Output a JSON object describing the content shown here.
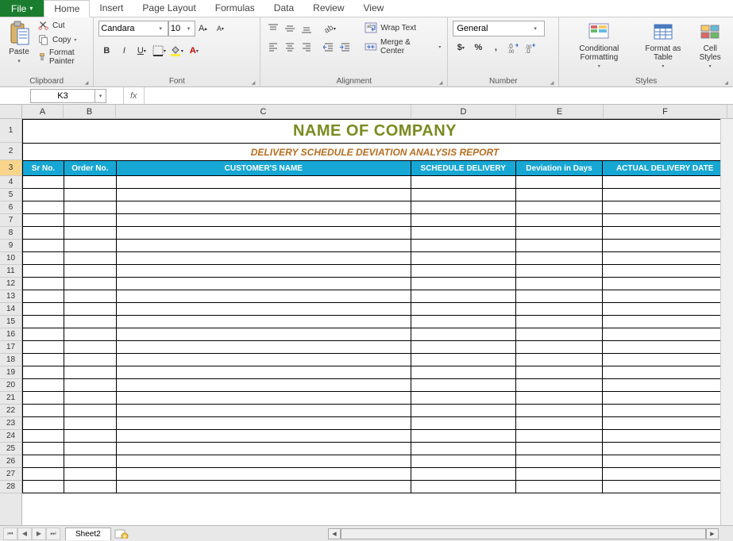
{
  "tabs": {
    "file": "File",
    "items": [
      "Home",
      "Insert",
      "Page Layout",
      "Formulas",
      "Data",
      "Review",
      "View"
    ],
    "active": "Home"
  },
  "ribbon": {
    "clipboard": {
      "label": "Clipboard",
      "paste": "Paste",
      "cut": "Cut",
      "copy": "Copy",
      "format_painter": "Format Painter"
    },
    "font": {
      "label": "Font",
      "name": "Candara",
      "size": "10"
    },
    "alignment": {
      "label": "Alignment",
      "wrap": "Wrap Text",
      "merge": "Merge & Center"
    },
    "number": {
      "label": "Number",
      "format": "General"
    },
    "styles": {
      "label": "Styles",
      "conditional": "Conditional Formatting",
      "table": "Format as Table",
      "cell": "Cell Styles"
    }
  },
  "namebox": "K3",
  "formula": "",
  "columns": [
    "A",
    "B",
    "C",
    "D",
    "E",
    "F"
  ],
  "rows_visible": 28,
  "selected_row": 3,
  "sheet": {
    "title": "NAME OF COMPANY",
    "subtitle": "DELIVERY SCHEDULE DEVIATION ANALYSIS REPORT",
    "headers": [
      "Sr No.",
      "Order No.",
      "CUSTOMER'S NAME",
      "SCHEDULE DELIVERY",
      "Deviation in Days",
      "ACTUAL DELIVERY DATE"
    ]
  },
  "sheet_tab": "Sheet2",
  "chart_data": {
    "type": "table",
    "title": "DELIVERY SCHEDULE DEVIATION ANALYSIS REPORT",
    "columns": [
      "Sr No.",
      "Order No.",
      "CUSTOMER'S NAME",
      "SCHEDULE DELIVERY",
      "Deviation in Days",
      "ACTUAL DELIVERY DATE"
    ],
    "rows": []
  }
}
